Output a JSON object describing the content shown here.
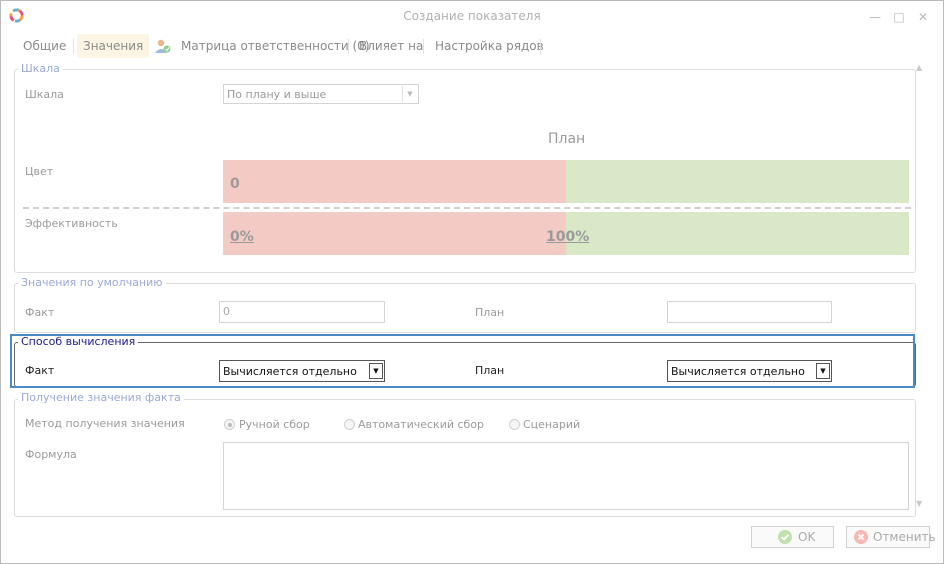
{
  "window": {
    "title": "Создание показателя",
    "controls": [
      "minimize-icon",
      "maximize-icon",
      "close-icon"
    ]
  },
  "tabs": [
    {
      "label": "Общие",
      "active": false
    },
    {
      "label": "Значения",
      "active": true
    },
    {
      "label": "Матрица ответственности (0)",
      "active": false,
      "icon": "users-icon"
    },
    {
      "label": "Влияет на",
      "active": false
    },
    {
      "label": "Настройка рядов",
      "active": false
    }
  ],
  "scale_group": {
    "title": "Шкала",
    "scale_label": "Шкала",
    "scale_value": "По плану и выше",
    "plan_header": "План",
    "color_label": "Цвет",
    "color_value": "0",
    "efficiency_label": "Эффективность",
    "eff_low": "0%",
    "eff_high": "100%",
    "colors": {
      "red": "#f3cac4",
      "green": "#d9e8c6"
    }
  },
  "defaults_group": {
    "title": "Значения по умолчанию",
    "fact_label": "Факт",
    "fact_value": "0",
    "plan_label": "План",
    "plan_value": ""
  },
  "calc_group": {
    "title": "Способ вычисления",
    "fact_label": "Факт",
    "fact_value": "Вычисляется отдельно",
    "plan_label": "План",
    "plan_value": "Вычисляется отдельно",
    "highlight_color": "#4a8bc6"
  },
  "fact_group": {
    "title": "Получение значения факта",
    "method_label": "Метод получения значения",
    "options": [
      {
        "label": "Ручной сбор",
        "selected": true
      },
      {
        "label": "Автоматический сбор",
        "selected": false
      },
      {
        "label": "Сценарий",
        "selected": false
      }
    ],
    "formula_label": "Формула",
    "formula_value": ""
  },
  "footer": {
    "ok_label": "OK",
    "cancel_label": "Отменить"
  }
}
